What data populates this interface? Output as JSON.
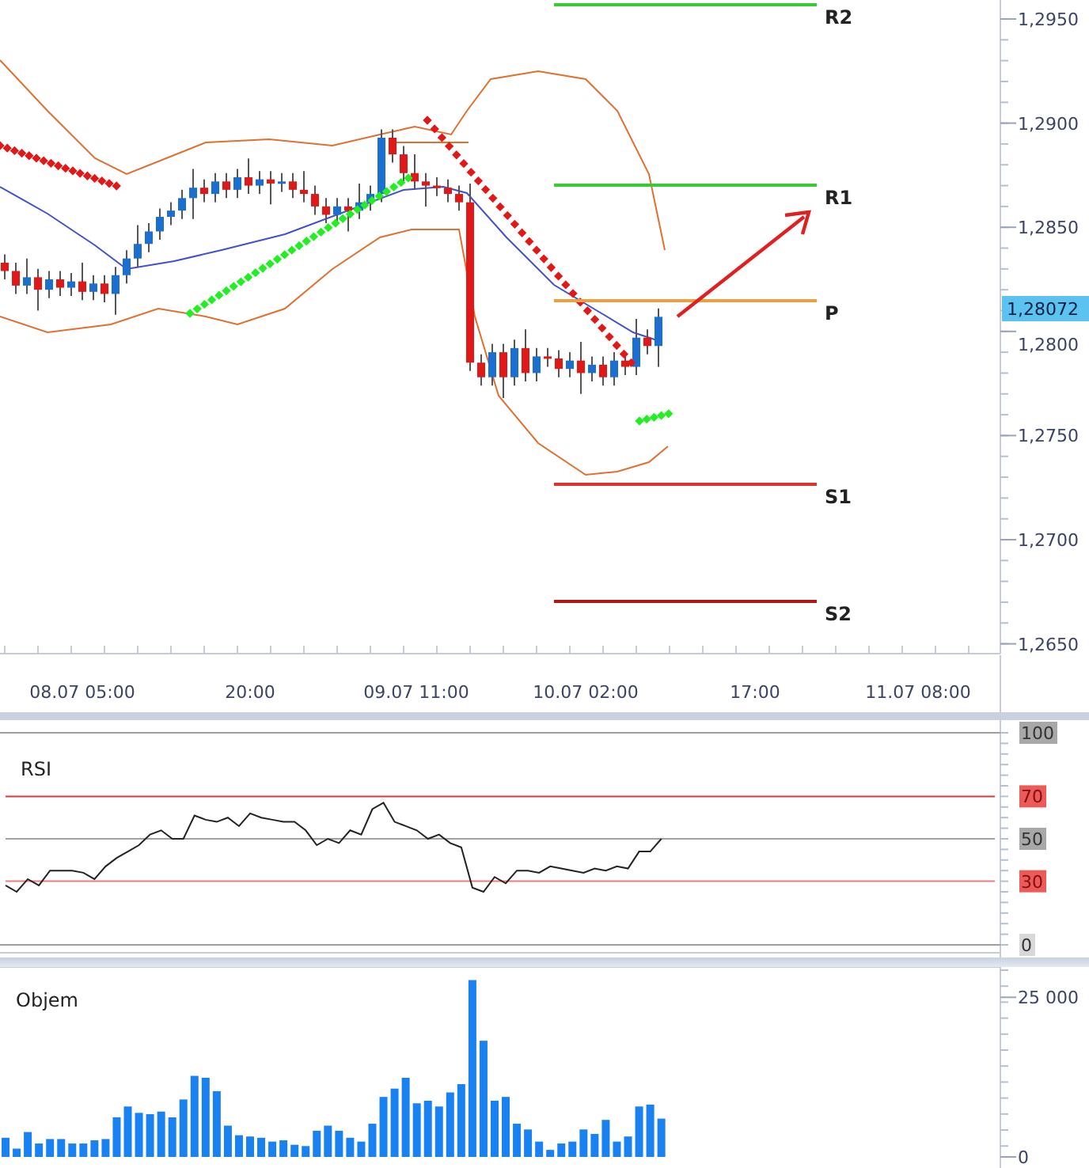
{
  "price_panel": {
    "price_ticks": [
      "1,2950",
      "1,2900",
      "1,2850",
      "1,2800",
      "1,2750",
      "1,2700",
      "1,2650"
    ],
    "current_price": "1,28072",
    "pivots": [
      {
        "label": "R2",
        "color": "#33cc33"
      },
      {
        "label": "R1",
        "color": "#33cc33"
      },
      {
        "label": "P",
        "color": "#e8a040"
      },
      {
        "label": "S1",
        "color": "#e03030"
      },
      {
        "label": "S2",
        "color": "#b01818"
      }
    ]
  },
  "time_axis": {
    "labels": [
      "08.07 05:00",
      "20:00",
      "09.07 11:00",
      "10.07 02:00",
      "17:00",
      "11.07 08:00"
    ]
  },
  "rsi_panel": {
    "title": "RSI",
    "chart_data": {
      "type": "line",
      "ylim": [
        0,
        100
      ],
      "yticks": [
        0,
        30,
        50,
        70,
        100
      ],
      "categories": [
        null,
        null,
        null,
        null,
        null,
        null,
        null,
        null,
        null,
        null,
        null,
        null,
        null,
        null,
        null,
        null,
        null,
        null,
        null,
        null,
        null,
        null,
        null,
        null,
        null,
        null,
        null,
        null,
        null,
        null,
        null,
        null,
        null,
        null,
        null,
        null,
        null,
        null,
        null,
        null,
        null,
        null,
        null,
        null,
        null,
        null,
        null,
        null,
        null,
        null,
        null,
        null,
        null,
        null,
        null,
        null,
        null,
        null,
        null,
        null,
        null,
        null,
        null,
        null,
        null,
        null,
        null,
        null,
        null,
        null,
        null,
        null,
        null,
        null,
        null,
        null,
        null,
        null,
        null,
        null,
        null,
        null,
        null,
        null,
        null,
        null,
        null,
        null,
        null,
        null
      ],
      "series": [
        {
          "color": "#d83a3a",
          "values": [
            70,
            70,
            70,
            70,
            70,
            70,
            70,
            70,
            70,
            70,
            70,
            70,
            70,
            70,
            70,
            70,
            70,
            70,
            70,
            70,
            70,
            70,
            70,
            70,
            70,
            70,
            70,
            70,
            70,
            70,
            70,
            70,
            70,
            70,
            70,
            70,
            70,
            70,
            70,
            70,
            70,
            70,
            70,
            70,
            70,
            70,
            70,
            70,
            70,
            70,
            70,
            70,
            70,
            70,
            70,
            70,
            70,
            70,
            70,
            70,
            70,
            70,
            70,
            70,
            70,
            70,
            70,
            70,
            70,
            70,
            70,
            70,
            70,
            70,
            70,
            70,
            70,
            70,
            70,
            70,
            70,
            70,
            70,
            70,
            70,
            70,
            70,
            70,
            70,
            70
          ]
        },
        {
          "color": "#a0a0a0",
          "values": [
            50,
            50,
            50,
            50,
            50,
            50,
            50,
            50,
            50,
            50,
            50,
            50,
            50,
            50,
            50,
            50,
            50,
            50,
            50,
            50,
            50,
            50,
            50,
            50,
            50,
            50,
            50,
            50,
            50,
            50,
            50,
            50,
            50,
            50,
            50,
            50,
            50,
            50,
            50,
            50,
            50,
            50,
            50,
            50,
            50,
            50,
            50,
            50,
            50,
            50,
            50,
            50,
            50,
            50,
            50,
            50,
            50,
            50,
            50,
            50,
            50,
            50,
            50,
            50,
            50,
            50,
            50,
            50,
            50,
            50,
            50,
            50,
            50,
            50,
            50,
            50,
            50,
            50,
            50,
            50,
            50,
            50,
            50,
            50,
            50,
            50,
            50,
            50,
            50,
            50
          ]
        },
        {
          "color": "#f07a80",
          "values": [
            30,
            30,
            30,
            30,
            30,
            30,
            30,
            30,
            30,
            30,
            30,
            30,
            30,
            30,
            30,
            30,
            30,
            30,
            30,
            30,
            30,
            30,
            30,
            30,
            30,
            30,
            30,
            30,
            30,
            30,
            30,
            30,
            30,
            30,
            30,
            30,
            30,
            30,
            30,
            30,
            30,
            30,
            30,
            30,
            30,
            30,
            30,
            30,
            30,
            30,
            30,
            30,
            30,
            30,
            30,
            30,
            30,
            30,
            30,
            30,
            30,
            30,
            30,
            30,
            30,
            30,
            30,
            30,
            30,
            30,
            30,
            30,
            30,
            30,
            30,
            30,
            30,
            30,
            30,
            30,
            30,
            30,
            30,
            30,
            30,
            30,
            30,
            30,
            30,
            30
          ]
        },
        {
          "color": "#222222",
          "values": [
            28,
            25,
            31,
            28,
            35,
            35,
            35,
            34,
            31,
            37,
            41,
            44,
            47,
            52,
            54,
            50,
            50,
            61,
            59,
            58,
            60,
            56,
            62,
            60,
            59,
            58,
            58,
            54,
            47,
            50,
            48,
            54,
            52,
            64,
            67,
            58,
            56,
            54,
            50,
            52,
            48,
            46,
            27,
            25,
            32,
            29,
            35,
            35,
            34,
            37,
            36,
            35,
            34,
            36,
            35,
            37,
            36,
            44,
            44,
            50,
            null,
            null,
            null,
            null,
            null,
            null,
            null,
            null,
            null,
            null,
            null,
            null,
            null,
            null,
            null,
            null,
            null,
            null,
            null,
            null,
            null,
            null,
            null,
            null,
            null,
            null,
            null,
            null,
            null,
            null
          ]
        }
      ]
    }
  },
  "volume_panel": {
    "title": "Objem",
    "chart_data": {
      "type": "bar",
      "ylim": [
        0,
        29500
      ],
      "yticks": [
        0,
        {
          "value": 25000,
          "label": "25 000"
        }
      ],
      "categories": [
        null,
        null,
        null,
        null,
        null,
        null,
        null,
        null,
        null,
        null,
        null,
        null,
        null,
        null,
        null,
        null,
        null,
        null,
        null,
        null,
        null,
        null,
        null,
        null,
        null,
        null,
        null,
        null,
        null,
        null,
        null,
        null,
        null,
        null,
        null,
        null,
        null,
        null,
        null,
        null,
        null,
        null,
        null,
        null,
        null,
        null,
        null,
        null,
        null,
        null,
        null,
        null,
        null,
        null,
        null,
        null,
        null,
        null,
        null,
        null,
        null,
        null,
        null,
        null,
        null,
        null,
        null,
        null,
        null,
        null,
        null,
        null,
        null,
        null,
        null,
        null,
        null,
        null,
        null,
        null,
        null,
        null,
        null,
        null,
        null,
        null,
        null,
        null,
        null,
        null
      ],
      "series": [
        {
          "color": "#1a82f0",
          "values": [
            3000,
            1300,
            3900,
            2100,
            2800,
            2800,
            2100,
            2100,
            2600,
            2800,
            6200,
            7900,
            6900,
            6700,
            7100,
            6200,
            9000,
            12700,
            12400,
            10300,
            4900,
            3400,
            3200,
            3000,
            2400,
            2600,
            1900,
            1700,
            4100,
            4900,
            4100,
            3000,
            2400,
            5200,
            9400,
            10700,
            12400,
            8400,
            8800,
            7900,
            10100,
            11400,
            27700,
            18200,
            8800,
            9400,
            5200,
            4300,
            2400,
            1100,
            2100,
            2400,
            4300,
            3600,
            5800,
            2400,
            3200,
            7900,
            8200,
            6000,
            null,
            null,
            null,
            null,
            null,
            null,
            null,
            null,
            null,
            null,
            null,
            null,
            null,
            null,
            null,
            null,
            null,
            null,
            null,
            null,
            null,
            null,
            null,
            null,
            null,
            null,
            null,
            null,
            null,
            null
          ]
        }
      ]
    }
  }
}
